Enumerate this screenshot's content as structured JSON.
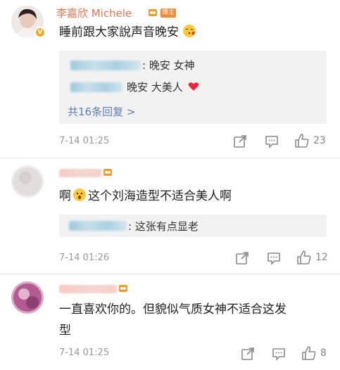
{
  "comments": [
    {
      "author": "李嘉欣 Michele",
      "role_badge": "博主",
      "text": "睡前跟大家說声音晚安",
      "replies": [
        {
          "text": "晚安 女神",
          "prefix": ":"
        },
        {
          "text": "晚安 大美人"
        }
      ],
      "more_replies": "共16条回复 >",
      "time": "7-14 01:25",
      "likes": "23"
    },
    {
      "text": "啊 这个刘海造型不适合美人啊",
      "replies": [
        {
          "text": ": 这张有点显老"
        }
      ],
      "time": "7-14 01:26",
      "likes": "12"
    },
    {
      "text_line1": "一直喜欢你的。但貌似气质女神不适合这发",
      "text_line2": "型",
      "time": "7-14 01:25",
      "likes": "8"
    }
  ],
  "colors": {
    "author_name": "#eb7350",
    "link": "#5b7fb5",
    "verified_badge": "#f5a623",
    "heart": "#e8283c"
  },
  "icons": [
    "verified-icon",
    "fan-badge-icon",
    "share-icon",
    "comment-icon",
    "like-icon",
    "heart-icon",
    "kiss-emoji",
    "surprised-emoji"
  ]
}
